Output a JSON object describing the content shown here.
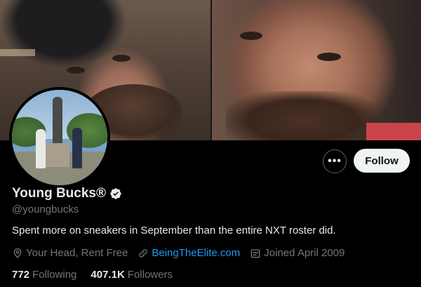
{
  "profile": {
    "name": "Young Bucks®",
    "handle": "@youngbucks",
    "bio": "Spent more on sneakers in September than the entire NXT roster did.",
    "location": "Your Head, Rent Free",
    "website": "BeingTheElite.com",
    "joined": "Joined April 2009",
    "verified": true
  },
  "actions": {
    "more_label": "•••",
    "follow_label": "Follow"
  },
  "stats": {
    "following_count": "772",
    "following_label": "Following",
    "followers_count": "407.1K",
    "followers_label": "Followers"
  },
  "colors": {
    "background": "#000000",
    "link": "#1d9bf0",
    "muted_text": "#71767b",
    "follow_button_bg": "#eff3f4"
  },
  "icons": [
    "location-icon",
    "link-icon",
    "calendar-icon",
    "verified-badge-icon",
    "more-icon"
  ]
}
